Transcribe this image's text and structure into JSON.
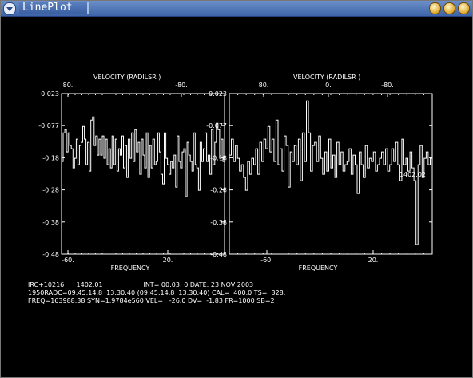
{
  "window": {
    "title": "LinePlot"
  },
  "icons": {
    "menu": "window-menu-icon",
    "minimize": "minimize-icon",
    "maximize": "maximize-icon",
    "close": "close-icon"
  },
  "colors": {
    "titlebar": "#4a70b4",
    "plot_bg": "#000000",
    "trace": "#ffffff"
  },
  "footer": {
    "line1": "IRC+10216      1402.01                    INT= 00:03: 0 DATE: 23 NOV 2003",
    "line2": "1950RADC=09:45:14.8  13:30:40 (09:45:14.8  13:30:40) CAL=  400.0 TS=  328.",
    "line3": "FREQ=163988.38 SYN=1.9784e560 VEL=   -26.0 DV=  -1.83 FR=1000 SB=2"
  },
  "chart_data": [
    {
      "type": "line",
      "title": "VELOCITY     (RADILSR )",
      "xlabel": "FREQUENCY",
      "ylabel": "",
      "ylim": [
        -0.48,
        0.023
      ],
      "yticks": [
        "0.023",
        "-0.077",
        "-0.18",
        "-0.28",
        "-0.38",
        "-0.48"
      ],
      "xticks_bottom": [
        "-60.",
        "20."
      ],
      "xticks_top": [
        "80.",
        "-80."
      ],
      "grid": false,
      "annotations": [],
      "series": [
        {
          "x": [
            0,
            1,
            2,
            3,
            4,
            5,
            6,
            7,
            8,
            9,
            10,
            11,
            12,
            13,
            14,
            15,
            16,
            17,
            18,
            19,
            20,
            21,
            22,
            23,
            24,
            25,
            26,
            27,
            28,
            29,
            30,
            31,
            32,
            33,
            34,
            35,
            36,
            37,
            38,
            39,
            40,
            41,
            42,
            43,
            44,
            45,
            46,
            47,
            48,
            49,
            50,
            51,
            52,
            53,
            54,
            55,
            56,
            57,
            58,
            59,
            60,
            61,
            62,
            63,
            64,
            65,
            66,
            67,
            68,
            69,
            70,
            71,
            72,
            73,
            74,
            75,
            76,
            77,
            78,
            79,
            80,
            81,
            82,
            83,
            84,
            85,
            86,
            87,
            88,
            89,
            90,
            91,
            92,
            93,
            94,
            95,
            96,
            97,
            98,
            99
          ],
          "values": [
            -0.19,
            -0.1,
            -0.09,
            -0.16,
            -0.1,
            -0.14,
            -0.15,
            -0.21,
            -0.18,
            -0.12,
            -0.2,
            -0.14,
            -0.13,
            -0.08,
            -0.12,
            -0.2,
            -0.13,
            -0.22,
            -0.06,
            -0.05,
            -0.14,
            -0.11,
            -0.17,
            -0.12,
            -0.17,
            -0.11,
            -0.18,
            -0.12,
            -0.2,
            -0.15,
            -0.21,
            -0.11,
            -0.2,
            -0.12,
            -0.22,
            -0.15,
            -0.17,
            -0.11,
            -0.21,
            -0.14,
            -0.24,
            -0.12,
            -0.18,
            -0.1,
            -0.19,
            -0.09,
            -0.16,
            -0.13,
            -0.23,
            -0.12,
            -0.17,
            -0.21,
            -0.1,
            -0.24,
            -0.14,
            -0.21,
            -0.12,
            -0.2,
            -0.19,
            -0.1,
            -0.16,
            -0.23,
            -0.26,
            -0.1,
            -0.18,
            -0.2,
            -0.23,
            -0.19,
            -0.21,
            -0.17,
            -0.27,
            -0.11,
            -0.19,
            -0.21,
            -0.16,
            -0.15,
            -0.3,
            -0.13,
            -0.17,
            -0.19,
            -0.22,
            -0.1,
            -0.2,
            -0.21,
            -0.28,
            -0.13,
            -0.19,
            -0.15,
            -0.1,
            -0.19,
            -0.17,
            -0.23,
            -0.09,
            -0.2,
            -0.13,
            -0.07,
            -0.09,
            -0.18,
            -0.12,
            -0.19
          ]
        }
      ]
    },
    {
      "type": "line",
      "title": "VELOCITY     (RADILSR )",
      "xlabel": "FREQUENCY",
      "ylabel": "",
      "ylim": [
        -0.48,
        0.023
      ],
      "yticks": [
        "0.023",
        "-0.077",
        "-0.18",
        "-0.28",
        "-0.38",
        "-0.48"
      ],
      "xticks_bottom": [
        "-60.",
        "20."
      ],
      "xticks_top": [
        "80.",
        "0.",
        "-80."
      ],
      "grid": false,
      "annotations": [
        {
          "text": "1402.02",
          "x": 92,
          "y": -0.23
        }
      ],
      "series": [
        {
          "x": [
            0,
            1,
            2,
            3,
            4,
            5,
            6,
            7,
            8,
            9,
            10,
            11,
            12,
            13,
            14,
            15,
            16,
            17,
            18,
            19,
            20,
            21,
            22,
            23,
            24,
            25,
            26,
            27,
            28,
            29,
            30,
            31,
            32,
            33,
            34,
            35,
            36,
            37,
            38,
            39,
            40,
            41,
            42,
            43,
            44,
            45,
            46,
            47,
            48,
            49,
            50,
            51,
            52,
            53,
            54,
            55,
            56,
            57,
            58,
            59,
            60,
            61,
            62,
            63,
            64,
            65,
            66,
            67,
            68,
            69,
            70,
            71,
            72,
            73,
            74,
            75,
            76,
            77,
            78,
            79,
            80,
            81,
            82,
            83,
            84,
            85,
            86,
            87,
            88,
            89,
            90,
            91,
            92,
            93,
            94,
            95,
            96,
            97,
            98,
            99
          ],
          "values": [
            -0.17,
            -0.12,
            -0.19,
            -0.14,
            -0.18,
            -0.22,
            -0.2,
            -0.24,
            -0.28,
            -0.19,
            -0.23,
            -0.18,
            -0.2,
            -0.15,
            -0.23,
            -0.13,
            -0.19,
            -0.12,
            -0.15,
            -0.08,
            -0.16,
            -0.12,
            -0.19,
            -0.06,
            -0.2,
            -0.15,
            -0.22,
            -0.11,
            -0.14,
            -0.27,
            -0.16,
            -0.19,
            -0.14,
            -0.2,
            -0.12,
            -0.25,
            -0.1,
            -0.19,
            0.0,
            -0.1,
            -0.22,
            -0.14,
            -0.13,
            -0.19,
            -0.11,
            -0.18,
            -0.23,
            -0.16,
            -0.22,
            -0.12,
            -0.21,
            -0.17,
            -0.24,
            -0.13,
            -0.2,
            -0.16,
            -0.22,
            -0.2,
            -0.19,
            -0.15,
            -0.23,
            -0.17,
            -0.2,
            -0.29,
            -0.16,
            -0.2,
            -0.24,
            -0.14,
            -0.21,
            -0.18,
            -0.19,
            -0.16,
            -0.22,
            -0.2,
            -0.18,
            -0.16,
            -0.2,
            -0.15,
            -0.22,
            -0.2,
            -0.15,
            -0.19,
            -0.13,
            -0.2,
            -0.25,
            -0.12,
            -0.2,
            -0.18,
            -0.22,
            -0.16,
            -0.21,
            -0.25,
            -0.45,
            -0.2,
            -0.14,
            -0.24,
            -0.18,
            -0.16,
            -0.2,
            -0.18
          ]
        }
      ]
    }
  ]
}
